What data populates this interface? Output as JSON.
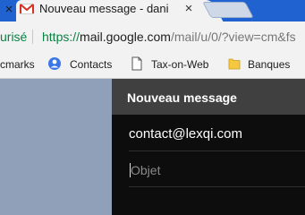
{
  "browser": {
    "tab": {
      "title": "Nouveau message - dani",
      "close_glyph": "×",
      "icon": "gmail-icon"
    },
    "prev_tab_close_glyph": "×",
    "address": {
      "security_label": "urisé",
      "scheme": "https://",
      "host": "mail.google.com",
      "path": "/mail/u/0/?view=cm&fs"
    },
    "bookmarks": [
      {
        "label": "cmarks",
        "icon": ""
      },
      {
        "label": "Contacts",
        "icon": "person-icon"
      },
      {
        "label": "Tax-on-Web",
        "icon": "page-icon"
      },
      {
        "label": "Banques",
        "icon": "folder-icon"
      }
    ]
  },
  "compose": {
    "title": "Nouveau message",
    "to": "contact@lexqi.com",
    "subject_placeholder": "Objet",
    "subject_value": ""
  },
  "colors": {
    "tab_strip": "#1f62d0",
    "secure_green": "#0b8043",
    "compose_header": "#404040",
    "compose_body": "#0d0d0d",
    "page_background": "#8fa0b8",
    "folder_yellow": "#f5c842"
  }
}
